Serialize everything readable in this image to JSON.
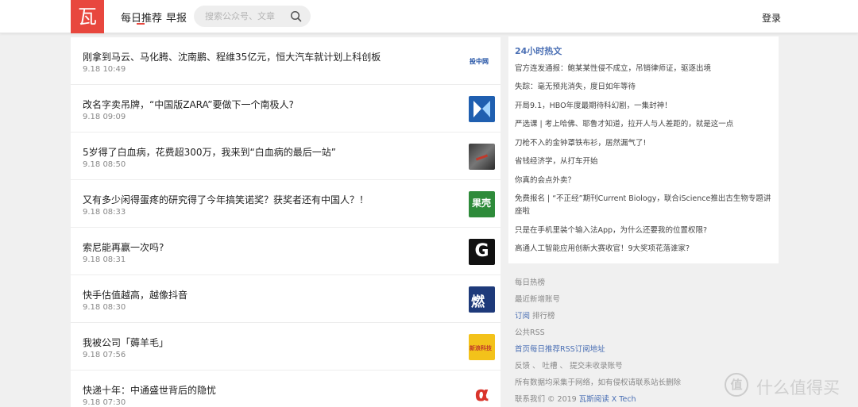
{
  "header": {
    "logo": "瓦",
    "nav_daily": "每日推荐",
    "nav_morning": "早报",
    "search_placeholder": "搜索公众号、文章",
    "login": "登录"
  },
  "articles": [
    {
      "title": "刚拿到马云、马化腾、沈南鹏、程维35亿元，恒大汽车就计划上科创板",
      "date": "9.18 10:49",
      "thumb": "投中网"
    },
    {
      "title": "改名字卖吊牌，“中国版ZARA”要做下一个南极人?",
      "date": "9.18 09:09",
      "thumb": ""
    },
    {
      "title": "5岁得了白血病，花费超300万，我来到“白血病的最后一站”",
      "date": "9.18 08:50",
      "thumb": ""
    },
    {
      "title": "又有多少闲得蛋疼的研究得了今年搞笑诺奖？获奖者还有中国人？！",
      "date": "9.18 08:33",
      "thumb": "果壳"
    },
    {
      "title": "索尼能再赢一次吗?",
      "date": "9.18 08:31",
      "thumb": "G"
    },
    {
      "title": "快手估值越高，越像抖音",
      "date": "9.18 08:30",
      "thumb": "燃"
    },
    {
      "title": "我被公司「薅羊毛」",
      "date": "9.18 07:56",
      "thumb": "新浪科技"
    },
    {
      "title": "快递十年：中通盛世背后的隐忧",
      "date": "9.18 07:30",
      "thumb": "α"
    }
  ],
  "hot": {
    "title": "24小时热文",
    "items": [
      "官方连发通报：鲍某某性侵不成立，吊销律师证，驱逐出境",
      "失踪：毫无预兆消失，度日如年等待",
      "开局9.1，HBO年度最期待科幻剧，一集封神！",
      "严选课 | 考上哈佛、耶鲁才知道，拉开人与人差距的，就是这一点",
      "刀枪不入的金钟罩铁布衫，居然漏气了!",
      "省钱经济学，从打车开始",
      "你真的会点外卖？",
      "免费报名 | “不正经”期刊Current Biology，联合iScience推出古生物专题讲座啦",
      "只是在手机里装个输入法App，为什么还要我的位置权限?",
      "高通人工智能应用创新大赛收官！9大奖项花落谁家?"
    ]
  },
  "links": {
    "daily_hot": "每日热榜",
    "new_accounts": "最近新增账号",
    "subscribe_a": "订阅",
    "subscribe_b": " 排行榜",
    "public_rss": "公共RSS",
    "home_rss": "首页每日推荐RSS订阅地址",
    "feedback": "反馈 、 吐槽 、 提交未收录账号",
    "disclaimer": "所有数据均采集于网络，如有侵权请联系站长删除",
    "contact_a": "联系我们 © 2019 ",
    "contact_b": "瓦斯阅读 X Tech"
  },
  "watermark": {
    "badge": "值",
    "text": "什么值得买"
  },
  "colors": {
    "brand_red": "#e8473e",
    "link_blue": "#4a6fb4"
  }
}
